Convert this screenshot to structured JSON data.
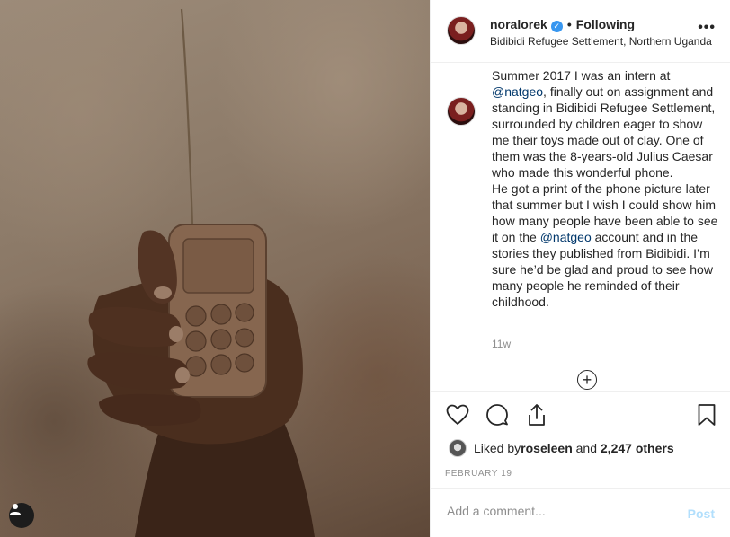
{
  "post": {
    "username": "noralorek",
    "verified_mark": "✓",
    "separator": "•",
    "follow_status": "Following",
    "location": "Bidibidi Refugee Settlement, Northern Uganda",
    "more_options": "•••"
  },
  "caption": {
    "part1": "Summer 2017 I was an intern at ",
    "mention1": "@natgeo",
    "part2": ", finally out on assignment and standing in Bidibidi Refugee Settlement, surrounded by children eager to show me their toys made out of clay. One of them was the 8-years-old Julius Caesar who made this wonderful phone.\nHe got a print of the phone picture later that summer but I wish I could show him how many people have been able to see it on the ",
    "mention2": "@natgeo",
    "part3": " account and in the stories they published from Bidibidi. I’m sure he’d be glad and proud to see how many people he reminded of their childhood.",
    "time_ago": "11w"
  },
  "load_more_symbol": "+",
  "likes": {
    "prefix": "Liked by ",
    "user": "roseleen",
    "middle": " and ",
    "others": "2,247 others"
  },
  "date": "FEBRUARY 19",
  "comment": {
    "placeholder": "Add a comment...",
    "post_label": "Post"
  },
  "icons": {
    "like": "heart-icon",
    "comment": "speech-bubble-icon",
    "share": "share-icon",
    "save": "bookmark-icon",
    "load_more": "plus-circle-icon",
    "tagged_user": "user-icon"
  },
  "colors": {
    "text": "#262626",
    "secondary": "#8e8e8e",
    "link": "#00376b",
    "verified": "#3897f0",
    "post_disabled": "#b2dffc",
    "divider": "#efefef"
  }
}
